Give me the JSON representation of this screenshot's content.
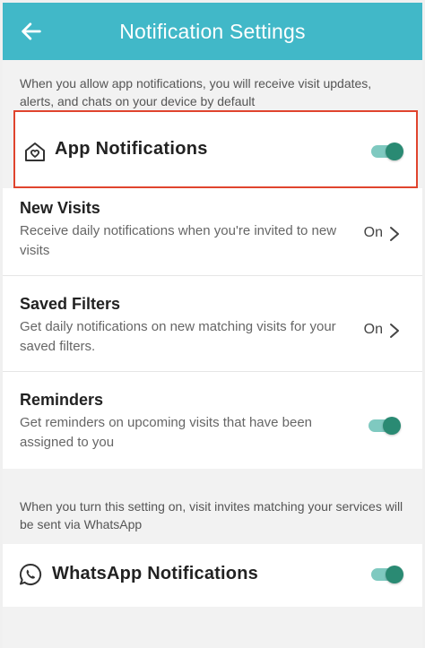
{
  "header": {
    "title": "Notification Settings",
    "back_icon": "arrow-left-icon"
  },
  "intro_text": "When you allow app notifications, you will receive visit updates, alerts, and chats on your device by default",
  "app_notifications": {
    "label": "App Notifications",
    "icon": "home-heart-icon",
    "enabled": true
  },
  "settings": [
    {
      "title": "New Visits",
      "description": "Receive daily notifications when you're invited to new visits",
      "value": "On"
    },
    {
      "title": "Saved Filters",
      "description": "Get daily notifications on new matching visits for your saved filters.",
      "value": "On"
    },
    {
      "title": "Reminders",
      "description": "Get reminders on upcoming visits that have been assigned to you",
      "enabled": true
    }
  ],
  "whatsapp_intro": "When you turn this setting on, visit invites matching your services will be sent via WhatsApp",
  "whatsapp": {
    "label": "WhatsApp Notifications",
    "icon": "whatsapp-icon",
    "enabled": true
  },
  "colors": {
    "header": "#41b8c8",
    "toggle_knob": "#2a8a73",
    "toggle_track": "#7fc9c0",
    "highlight_border": "#e0442e"
  }
}
